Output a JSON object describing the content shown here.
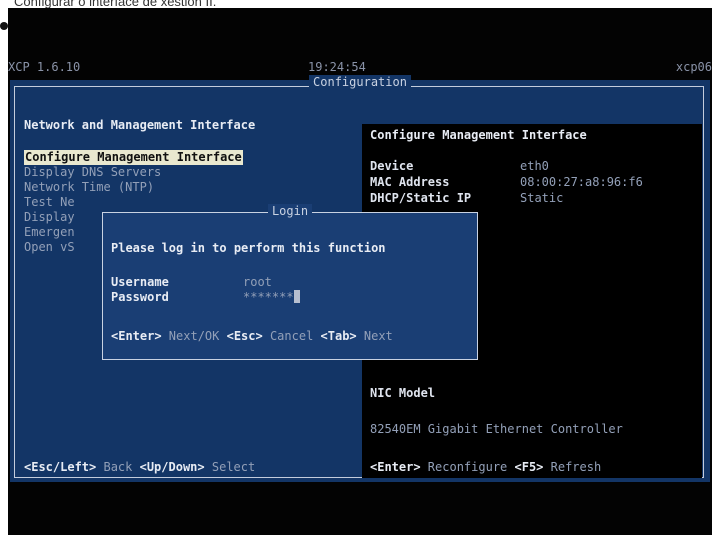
{
  "caption": "Configurar o interface de xestión II.",
  "header": {
    "version": "XCP 1.6.10",
    "clock": "19:24:54",
    "host": "xcp06"
  },
  "frame": {
    "title": "Configuration"
  },
  "left": {
    "heading": "Network and Management Interface",
    "menu": [
      "Configure Management Interface",
      "Display DNS Servers",
      "Network Time (NTP)",
      "Test Ne",
      "Display",
      "Emergen",
      "Open vS"
    ],
    "footer": {
      "k1": "<Esc/Left>",
      "t1": " Back ",
      "k2": "<Up/Down>",
      "t2": " Select"
    }
  },
  "right": {
    "heading": "Configure Management Interface",
    "rows": [
      {
        "label": "Device",
        "value": "eth0"
      },
      {
        "label": "MAC Address",
        "value": "08:00:27:a8:96:f6"
      },
      {
        "label": "DHCP/Static IP",
        "value": "Static"
      }
    ],
    "nic_label": "NIC Model",
    "nic_value": "82540EM Gigabit Ethernet Controller",
    "footer": {
      "k1": "<Enter>",
      "t1": " Reconfigure ",
      "k2": "<F5>",
      "t2": " Refresh"
    }
  },
  "dialog": {
    "title": "Login",
    "prompt": "Please log in to perform this function",
    "username_label": "Username",
    "username_value": "root",
    "password_label": "Password",
    "password_value": "*******",
    "footer": {
      "k1": "<Enter>",
      "t1": " Next/OK ",
      "k2": "<Esc>",
      "t2": " Cancel ",
      "k3": "<Tab>",
      "t3": " Next"
    }
  }
}
